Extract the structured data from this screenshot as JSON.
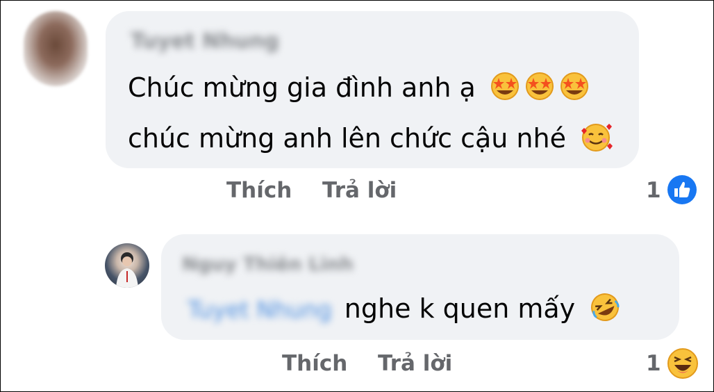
{
  "comment1": {
    "author": "Tuyet Nhung",
    "line1": "Chúc mừng gia đình anh ạ",
    "line1_emojis": [
      "star-struck-emoji",
      "star-struck-emoji",
      "star-struck-emoji"
    ],
    "line2": "chúc mừng anh lên chức cậu nhé",
    "line2_emoji": "smiling-face-with-hearts-emoji",
    "like_label": "Thích",
    "reply_label": "Trả lời",
    "reaction_count": "1",
    "reaction_icon": "like-icon",
    "colors": {
      "like": "#1877f2"
    }
  },
  "comment2": {
    "author": "Nguy Thiên Linh",
    "mention": "Tuyet Nhung",
    "text": "nghe k quen mấy",
    "text_emoji": "rolling-on-floor-laughing-emoji",
    "like_label": "Thích",
    "reply_label": "Trả lời",
    "reaction_count": "1",
    "reaction_icon": "haha-icon"
  }
}
